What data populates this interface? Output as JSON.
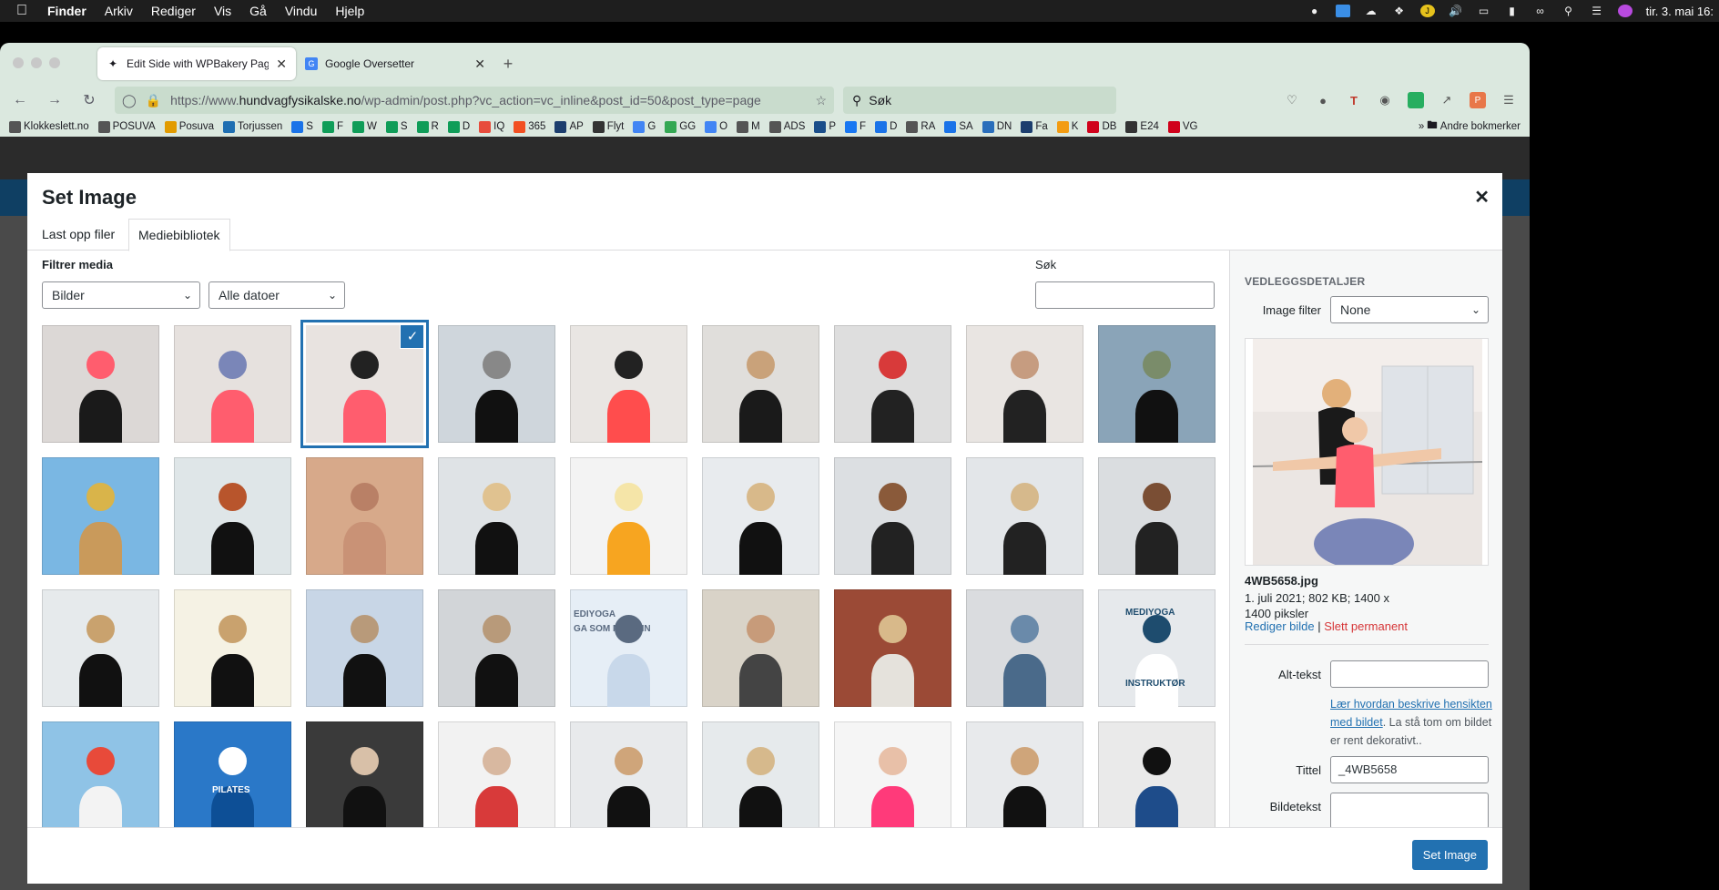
{
  "menubar": {
    "app": "Finder",
    "items": [
      "Arkiv",
      "Rediger",
      "Vis",
      "Gå",
      "Vindu",
      "Hjelp"
    ],
    "clock": "tir. 3. mai 16:"
  },
  "browser": {
    "tabs": [
      {
        "title": "Edit Side with WPBakery Page B"
      },
      {
        "title": "Google Oversetter"
      }
    ],
    "url_prefix": "https://www.",
    "url_domain": "hundvagfysikalske.no",
    "url_path": "/wp-admin/post.php?vc_action=vc_inline&post_id=50&post_type=page",
    "search_placeholder": "Søk",
    "bookmarks": [
      {
        "label": "Klokkeslett.no",
        "color": "#555"
      },
      {
        "label": "POSUVA",
        "color": "#555"
      },
      {
        "label": "Posuva",
        "color": "#e29b00"
      },
      {
        "label": "Torjussen",
        "color": "#1f6fb2"
      },
      {
        "label": "S",
        "color": "#1a73e8"
      },
      {
        "label": "F",
        "color": "#0f9d58"
      },
      {
        "label": "W",
        "color": "#0f9d58"
      },
      {
        "label": "S",
        "color": "#0f9d58"
      },
      {
        "label": "R",
        "color": "#0f9d58"
      },
      {
        "label": "D",
        "color": "#0f9d58"
      },
      {
        "label": "IQ",
        "color": "#e74c3c"
      },
      {
        "label": "365",
        "color": "#f25022"
      },
      {
        "label": "AP",
        "color": "#1c3e6e"
      },
      {
        "label": "Flyt",
        "color": "#333"
      },
      {
        "label": "G",
        "color": "#4285f4"
      },
      {
        "label": "GG",
        "color": "#34a853"
      },
      {
        "label": "O",
        "color": "#4285f4"
      },
      {
        "label": "M",
        "color": "#555"
      },
      {
        "label": "ADS",
        "color": "#555"
      },
      {
        "label": "P",
        "color": "#1a4e8a"
      },
      {
        "label": "F",
        "color": "#1877f2"
      },
      {
        "label": "D",
        "color": "#1a73e8"
      },
      {
        "label": "RA",
        "color": "#555"
      },
      {
        "label": "SA",
        "color": "#1a73e8"
      },
      {
        "label": "DN",
        "color": "#2a6ebb"
      },
      {
        "label": "Fa",
        "color": "#1c3e6e"
      },
      {
        "label": "K",
        "color": "#f39c12"
      },
      {
        "label": "DB",
        "color": "#d0021b"
      },
      {
        "label": "E24",
        "color": "#333"
      },
      {
        "label": "VG",
        "color": "#d0021b"
      }
    ],
    "other_bookmarks": "Andre bokmerker"
  },
  "modal": {
    "title": "Set Image",
    "tabs": [
      "Last opp filer",
      "Mediebibliotek"
    ],
    "filter_label": "Filtrer media",
    "type_filter": "Bilder",
    "date_filter": "Alle datoer",
    "search_label": "Søk",
    "sidebar": {
      "title": "Vedleggsdetaljer",
      "image_filter_label": "Image filter",
      "image_filter_value": "None",
      "filename": "4WB5658.jpg",
      "meta_line1": "1. juli 2021; 802 KB; 1400 x",
      "meta_line2": "1400 piksler",
      "edit_link": "Rediger bilde",
      "separator": "|",
      "delete_link": "Slett permanent",
      "alt_label": "Alt-tekst",
      "alt_value": "",
      "help_link": "Lær hvordan beskrive hensikten med bildet",
      "help_text": ". La stå tom om bildet er rent dekorativt..",
      "title_label": "Tittel",
      "title_value": "_4WB5658",
      "caption_label": "Bildetekst"
    },
    "button": "Set Image"
  },
  "grid": {
    "selected_index": 2,
    "items": [
      {
        "name": "two-women-window",
        "bg": "#dcd8d6",
        "shirt": "#1a1a1a",
        "accent": "#ff5d6e"
      },
      {
        "name": "balance-ball-coach",
        "bg": "#e6e1de",
        "shirt": "#ff5d6e",
        "accent": "#7a86b8"
      },
      {
        "name": "child-arms-out",
        "bg": "#e8e3e0",
        "shirt": "#ff5d6e",
        "accent": "#222"
      },
      {
        "name": "team-on-balls",
        "bg": "#cfd6dc",
        "shirt": "#111",
        "accent": "#888"
      },
      {
        "name": "spine-treatment",
        "bg": "#e9e6e3",
        "shirt": "#ff4d4d",
        "accent": "#222"
      },
      {
        "name": "spine-model",
        "bg": "#e0dedb",
        "shirt": "#1a1a1a",
        "accent": "#c9a27a"
      },
      {
        "name": "shockwave-foot",
        "bg": "#dedede",
        "shirt": "#222",
        "accent": "#d83a3a"
      },
      {
        "name": "head-massage",
        "bg": "#e9e5e2",
        "shirt": "#222",
        "accent": "#c69c80"
      },
      {
        "name": "team-outdoor",
        "bg": "#8aa4b8",
        "shirt": "#111",
        "accent": "#7a8c6a"
      },
      {
        "name": "wooden-mannequin",
        "bg": "#7ab7e3",
        "shirt": "#c99a5b",
        "accent": "#d9b44a"
      },
      {
        "name": "portrait-red-hair",
        "bg": "#dfe6e8",
        "shirt": "#111",
        "accent": "#b8552c"
      },
      {
        "name": "back-massage",
        "bg": "#d7a98a",
        "shirt": "#c99276",
        "accent": "#b98066"
      },
      {
        "name": "shoulder-therapy",
        "bg": "#dfe3e6",
        "shirt": "#111",
        "accent": "#e0c290"
      },
      {
        "name": "vertebra-model",
        "bg": "#f3f3f3",
        "shirt": "#f7a520",
        "accent": "#f5e5a8"
      },
      {
        "name": "portrait-blonde-1",
        "bg": "#e8ebee",
        "shirt": "#111",
        "accent": "#d8b98a"
      },
      {
        "name": "portrait-brown-1",
        "bg": "#dcdfe2",
        "shirt": "#222",
        "accent": "#8a5a3a"
      },
      {
        "name": "portrait-blonde-2",
        "bg": "#e3e6e9",
        "shirt": "#222",
        "accent": "#d6b98c"
      },
      {
        "name": "portrait-brown-2",
        "bg": "#dadde0",
        "shirt": "#222",
        "accent": "#7a4e34"
      },
      {
        "name": "portrait-smile-1",
        "bg": "#e6eaec",
        "shirt": "#111",
        "accent": "#c9a26e"
      },
      {
        "name": "portrait-smile-2",
        "bg": "#f5f2e4",
        "shirt": "#111",
        "accent": "#c9a26e"
      },
      {
        "name": "yoga-warrior",
        "bg": "#c8d6e6",
        "shirt": "#111",
        "accent": "#b89a7a"
      },
      {
        "name": "yoga-tree",
        "bg": "#d2d5d8",
        "shirt": "#111",
        "accent": "#b89a7a"
      },
      {
        "name": "mediyoga-poster",
        "bg": "#e6eef6",
        "shirt": "#c8d8ea",
        "accent": "#5a6a80"
      },
      {
        "name": "meditation-group",
        "bg": "#d9d3c8",
        "shirt": "#444",
        "accent": "#c79b7a"
      },
      {
        "name": "meditation-brick",
        "bg": "#9b4a36",
        "shirt": "#e5e2dc",
        "accent": "#d8b98a"
      },
      {
        "name": "exercise-ball",
        "bg": "#dadcdf",
        "shirt": "#4a6a8a",
        "accent": "#6a8aaa"
      },
      {
        "name": "mediyoga-logo",
        "bg": "#e6e9ec",
        "shirt": "#fff",
        "accent": "#1e4c6e"
      },
      {
        "name": "pilates-flyers",
        "bg": "#8fc3e6",
        "shirt": "#f3f3f3",
        "accent": "#e84a3a"
      },
      {
        "name": "pilates-ball",
        "bg": "#2a78c8",
        "shirt": "#0d4f96",
        "accent": "#fff"
      },
      {
        "name": "floor-exercise",
        "bg": "#3a3a3a",
        "shirt": "#111",
        "accent": "#d8c0a8"
      },
      {
        "name": "shockwave-arm",
        "bg": "#f2f2f2",
        "shirt": "#d83a3a",
        "accent": "#d8b8a0"
      },
      {
        "name": "team-studio-1",
        "bg": "#e8eaec",
        "shirt": "#111",
        "accent": "#cfa57a"
      },
      {
        "name": "portrait-smile-3",
        "bg": "#e6eaec",
        "shirt": "#111",
        "accent": "#d6b98c"
      },
      {
        "name": "balance-pad-feet",
        "bg": "#f5f5f5",
        "shirt": "#ff3a7a",
        "accent": "#e8c0a8"
      },
      {
        "name": "team-studio-2",
        "bg": "#e8eaec",
        "shirt": "#111",
        "accent": "#cfa57a"
      },
      {
        "name": "bosu-balance",
        "bg": "#eaeaea",
        "shirt": "#1e4c8a",
        "accent": "#111"
      }
    ],
    "poster_line1": "EDIYOGA",
    "poster_line2": "GA SOM MEDISIN",
    "logo_line1": "MEDIYOGA",
    "logo_line2": "INSTRUKTØR",
    "pilates_text": "PILATES"
  },
  "colors": {
    "accent": "#2271b1",
    "delete": "#d63638",
    "tab_bar": "#dbe8df"
  }
}
